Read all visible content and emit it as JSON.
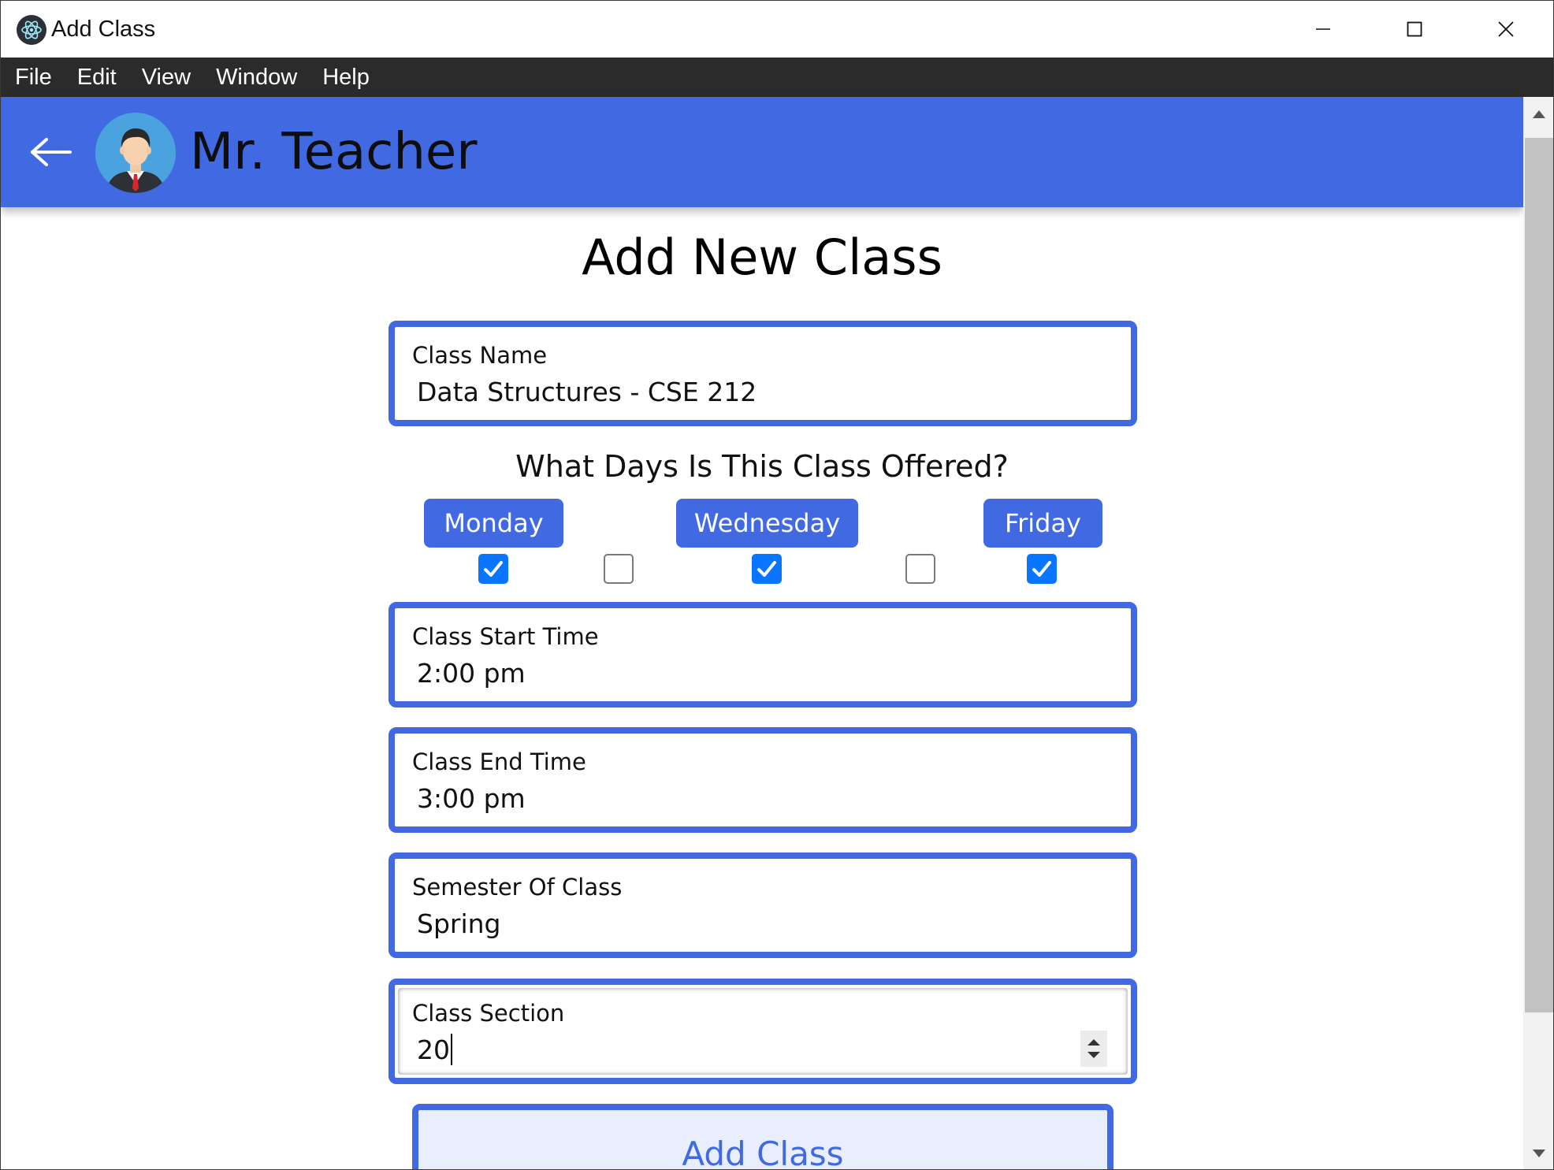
{
  "window": {
    "title": "Add Class"
  },
  "menu": {
    "items": [
      "File",
      "Edit",
      "View",
      "Window",
      "Help"
    ]
  },
  "header": {
    "teacher_name": "Mr. Teacher",
    "back_icon": "arrow-left-icon",
    "color": "#4169e1"
  },
  "form": {
    "title": "Add New Class",
    "class_name": {
      "label": "Class Name",
      "value": "Data Structures - CSE 212"
    },
    "days_question": "What Days Is This Class Offered?",
    "days": {
      "monday": {
        "label": "Monday",
        "checked": true
      },
      "tuesday": {
        "checked": false
      },
      "wednesday": {
        "label": "Wednesday",
        "checked": true
      },
      "thursday": {
        "checked": false
      },
      "friday": {
        "label": "Friday",
        "checked": true
      }
    },
    "start_time": {
      "label": "Class Start Time",
      "value": "2:00 pm"
    },
    "end_time": {
      "label": "Class End Time",
      "value": "3:00 pm"
    },
    "semester": {
      "label": "Semester Of Class",
      "value": "Spring"
    },
    "section": {
      "label": "Class Section",
      "value": "20"
    },
    "submit_label": "Add Class"
  },
  "colors": {
    "accent": "#4169e1",
    "checkbox": "#0a75ff",
    "menubar": "#2b2b2b"
  }
}
